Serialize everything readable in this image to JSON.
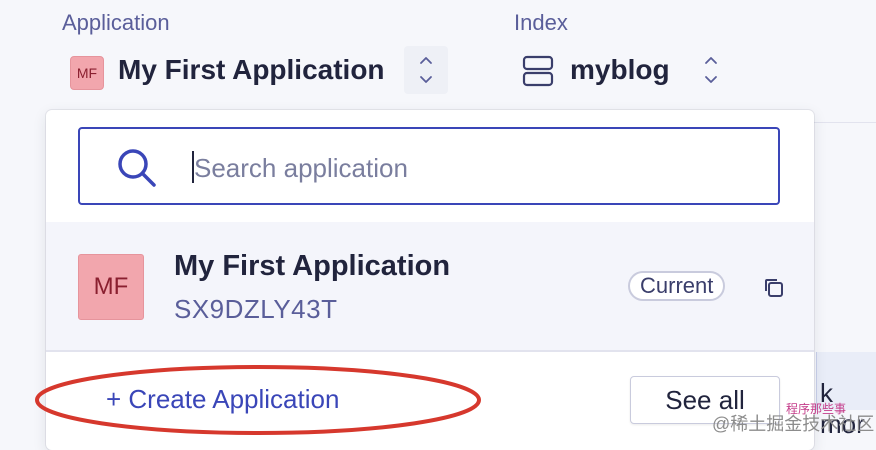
{
  "application": {
    "label": "Application",
    "initials": "MF",
    "name": "My First Application"
  },
  "index": {
    "label": "Index",
    "name": "myblog"
  },
  "dropdown": {
    "search_placeholder": "Search application",
    "app": {
      "initials": "MF",
      "name": "My First Application",
      "id": "SX9DZLY43T",
      "badge": "Current"
    },
    "create_label": "+ Create Application",
    "see_all_label": "See all"
  },
  "background": {
    "partial_text": "k mor"
  },
  "watermark": {
    "line1": "程序那些事",
    "line2": "@稀土掘金技术社区"
  },
  "colors": {
    "accent": "#3a46b8",
    "chip_bg": "#f2a6ad",
    "annotation": "#d6382d"
  },
  "icons": {
    "search": "search-icon",
    "index": "database-icon",
    "copy": "copy-icon",
    "stepper": "chevron-up-down-icon"
  }
}
